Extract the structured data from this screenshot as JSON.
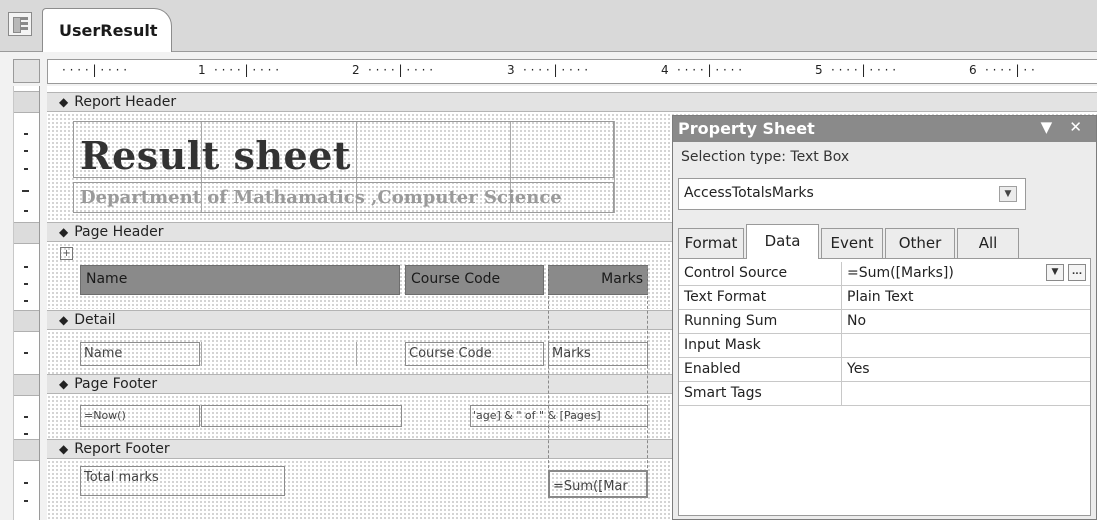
{
  "document_tab": {
    "label": "UserResult",
    "icon": "report-icon"
  },
  "ruler": {
    "numbers": [
      "1",
      "2",
      "3",
      "4",
      "5",
      "6"
    ]
  },
  "sections": {
    "report_header": "Report Header",
    "page_header": "Page Header",
    "detail": "Detail",
    "page_footer": "Page Footer",
    "report_footer": "Report Footer"
  },
  "report_header": {
    "title": "Result sheet",
    "subtitle": "Department of Mathamatics ,Computer Science"
  },
  "page_header": {
    "name_label": "Name",
    "course_code_label": "Course Code",
    "marks_label": "Marks"
  },
  "detail": {
    "name_field": "Name",
    "course_code_field": "Course Code",
    "marks_field": "Marks"
  },
  "page_footer": {
    "date_field": "=Now()",
    "page_field": "'age] & \" of \" & [Pages]"
  },
  "report_footer": {
    "total_label": "Total marks",
    "total_field": "=Sum([Mar"
  },
  "property_sheet": {
    "title": "Property Sheet",
    "title_buttons": "▼ ✕",
    "selection_type": "Selection type:  Text Box",
    "control_name": "AccessTotalsMarks",
    "tabs": [
      "Format",
      "Data",
      "Event",
      "Other",
      "All"
    ],
    "active_tab": "Data",
    "rows": [
      {
        "name": "Control Source",
        "value": "=Sum([Marks])"
      },
      {
        "name": "Text Format",
        "value": "Plain Text"
      },
      {
        "name": "Running Sum",
        "value": "No"
      },
      {
        "name": "Input Mask",
        "value": ""
      },
      {
        "name": "Enabled",
        "value": "Yes"
      },
      {
        "name": "Smart Tags",
        "value": ""
      }
    ],
    "builder_button": "...",
    "dropdown_glyph": "▼"
  },
  "colors": {
    "section_bar": "#e3e3e3",
    "label_fill": "#8a8a8a",
    "property_title": "#8a8a8a"
  }
}
